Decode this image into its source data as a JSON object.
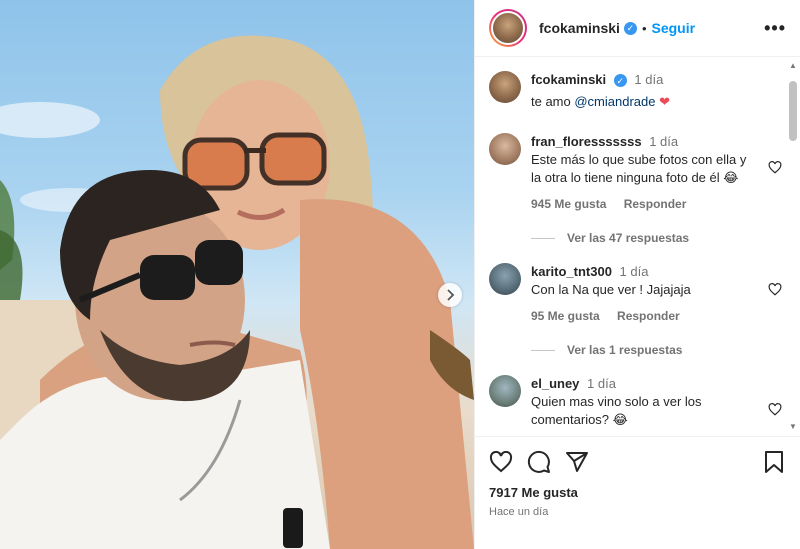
{
  "header": {
    "username": "fcokaminski",
    "follow_label": "Seguir",
    "more_label": "•••"
  },
  "caption": {
    "username": "fcokaminski",
    "time": "1 día",
    "text_prefix": "te amo ",
    "mention": "@cmiandrade",
    "emoji": "❤"
  },
  "comments": [
    {
      "username": "fran_floresssssss",
      "time": "1 día",
      "text": "Este más lo que sube fotos con ella y la otra lo tiene ninguna foto de él 😂",
      "likes": "945 Me gusta",
      "reply_label": "Responder",
      "replies": "Ver las 47 respuestas"
    },
    {
      "username": "karito_tnt300",
      "time": "1 día",
      "text": "Con la Na que ver ! Jajajaja",
      "likes": "95 Me gusta",
      "reply_label": "Responder",
      "replies": "Ver las 1 respuestas"
    },
    {
      "username": "el_uney",
      "time": "1 día",
      "text": "Quien mas vino solo a ver los comentarios? 😂"
    }
  ],
  "footer": {
    "likes": "7917 Me gusta",
    "ago": "Hace un día"
  },
  "colors": {
    "accent": "#0095f6",
    "verified": "#3897f0",
    "heart": "#ed4956"
  },
  "icons": [
    "verified-icon",
    "heart-icon",
    "comment-icon",
    "share-icon",
    "save-icon",
    "chevron-right-icon",
    "more-icon"
  ]
}
